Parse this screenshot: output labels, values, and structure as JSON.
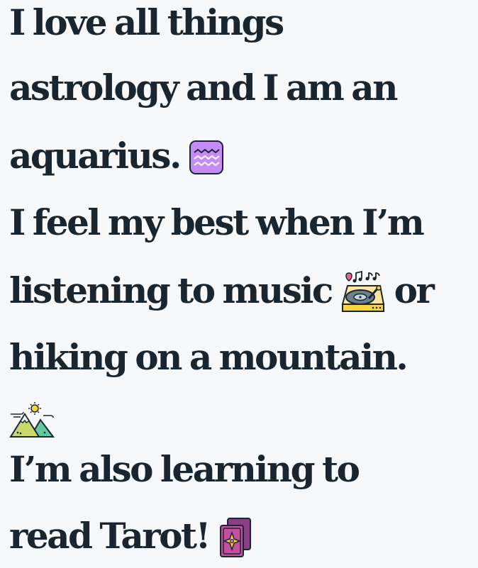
{
  "bio": {
    "line1": "I love all things",
    "line2": "astrology and I am an",
    "line3": "aquarius.",
    "line4": "I feel my best when I’m",
    "line5a": "listening to music",
    "line5b": "or",
    "line6": "hiking on a mountain.",
    "line8": "I’m also learning to",
    "line9": "read Tarot!"
  },
  "icons": {
    "aquarius": "aquarius-icon",
    "music": "record-player-icon",
    "mountain": "mountain-icon",
    "tarot": "tarot-cards-icon"
  },
  "colors": {
    "text": "#19262f",
    "background": "#f6f8fa",
    "aquarius": "#c68cf5",
    "record_player": "#f7d53b",
    "mountain_left": "#c9d86a",
    "mountain_right": "#62c99e",
    "tarot": "#8a3f86"
  }
}
